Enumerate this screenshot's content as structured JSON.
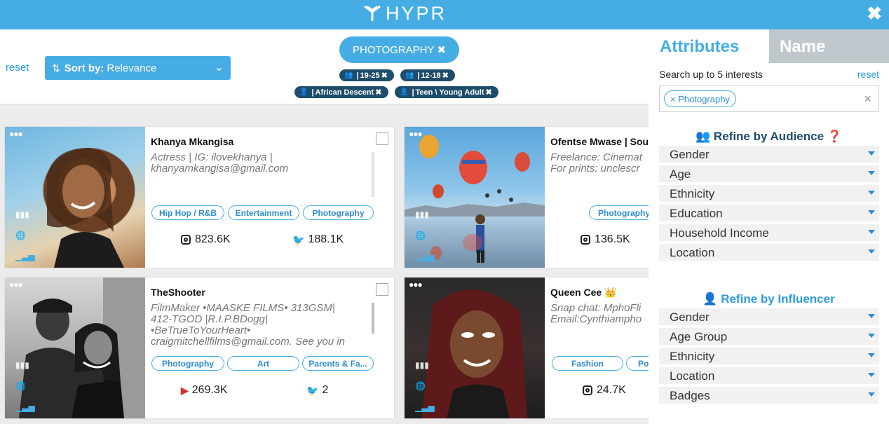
{
  "app": {
    "brand": "HYPR",
    "close_label": "✖"
  },
  "filters": {
    "reset_label": "reset",
    "sort_prefix": "Sort by:",
    "sort_value": "Relevance",
    "main_chip": "PHOTOGRAPHY ✖",
    "audience_chips": [
      {
        "label": "19-25",
        "remove": "✖"
      },
      {
        "label": "12-18",
        "remove": "✖"
      }
    ],
    "influencer_chips": [
      {
        "label": "African Descent",
        "remove": "✖"
      },
      {
        "label": "Teen \\ Young Adult",
        "remove": "✖"
      }
    ]
  },
  "cards": [
    {
      "name": "Khanya Mkangisa",
      "bio": "Actress | IG: ilovekhanya | khanyamkangisa@gmail.com",
      "tags": [
        "Hip Hop / R&B",
        "Entertainment",
        "Photography"
      ],
      "stats": [
        {
          "platform": "instagram",
          "value": "823.6K"
        },
        {
          "platform": "twitter",
          "value": "188.1K"
        }
      ]
    },
    {
      "name": "Ofentse Mwase | Sou",
      "bio": "Freelance: Cinemat For prints: unclescr",
      "tags": [
        "Photography"
      ],
      "stats": [
        {
          "platform": "instagram",
          "value": "136.5K"
        }
      ]
    },
    {
      "name": "TheShooter",
      "bio": "FilmMaker •MAASKE FILMS• 313GSM| 412-TGOD |R.I.P.BDogg| •BeTrueToYourHeart• craigmitchellfilms@gmail.com. See you in",
      "tags": [
        "Photography",
        "Art",
        "Parents & Fa..."
      ],
      "stats": [
        {
          "platform": "youtube",
          "value": "269.3K"
        },
        {
          "platform": "twitter",
          "value": "2"
        }
      ]
    },
    {
      "name": "Queen Cee 👑",
      "bio": "Snap chat: MphoFli Email:Cynthiampho",
      "tags": [
        "Fashion",
        "Polit"
      ],
      "stats": [
        {
          "platform": "instagram",
          "value": "24.7K"
        }
      ]
    }
  ],
  "panel": {
    "tab_attributes": "Attributes",
    "tab_name": "Name",
    "search_label": "Search up to 5 interests",
    "reset_label": "reset",
    "interest_chip": "× Photography",
    "clear": "×",
    "audience_title": "Refine by Audience",
    "audience_items": [
      "Gender",
      "Age",
      "Ethnicity",
      "Education",
      "Household Income",
      "Location"
    ],
    "influencer_title": "Refine by Influencer",
    "influencer_items": [
      "Gender",
      "Age Group",
      "Ethnicity",
      "Location",
      "Badges"
    ]
  },
  "colors": {
    "accent": "#46ade4",
    "dark": "#1d4d6b",
    "panel_tab_inactive": "#c0c8cd"
  }
}
